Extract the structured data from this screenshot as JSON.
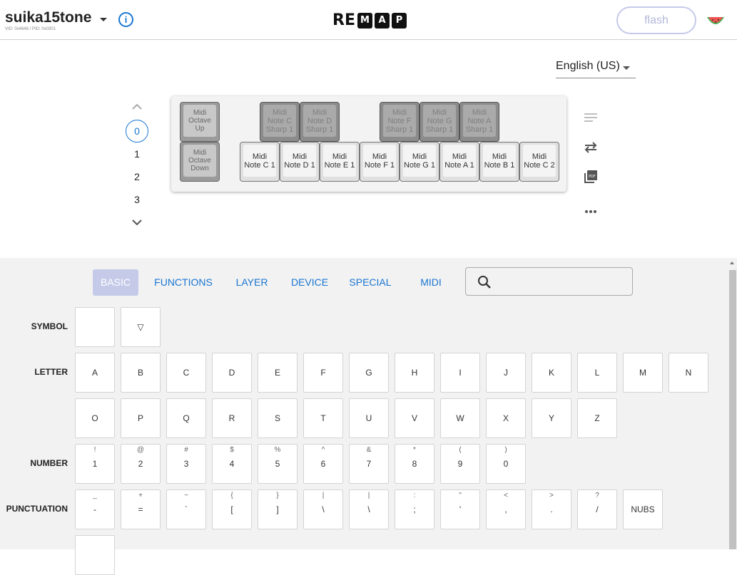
{
  "header": {
    "keyboard_name": "suika15tone",
    "vid_pid": "VID: 0x4648 / PID: 0x0301",
    "info_icon": "info-icon",
    "logo": [
      "R",
      "E",
      "M",
      "A",
      "P"
    ],
    "flash_label": "flash",
    "avatar_icon": "watermelon-icon"
  },
  "layout_select": {
    "value": "English (US)"
  },
  "layers": [
    "0",
    "1",
    "2",
    "3"
  ],
  "keyboard": {
    "top_row": [
      {
        "label": "Midi Octave Up"
      },
      {
        "label": "Midi Note C Sharp 1"
      },
      {
        "label": "Midi Note D Sharp 1"
      },
      {
        "label": "Midi Note F Sharp 1"
      },
      {
        "label": "Midi Note G Sharp 1"
      },
      {
        "label": "Midi Note A Sharp 1"
      }
    ],
    "bottom_row": [
      {
        "label": "Midi Octave Down"
      },
      {
        "label": "Midi Note C 1"
      },
      {
        "label": "Midi Note D 1"
      },
      {
        "label": "Midi Note E 1"
      },
      {
        "label": "Midi Note F 1"
      },
      {
        "label": "Midi Note G 1"
      },
      {
        "label": "Midi Note A 1"
      },
      {
        "label": "Midi Note B 1"
      },
      {
        "label": "Midi Note C 2"
      }
    ]
  },
  "side_icons": [
    "notes-icon",
    "swap-icon",
    "pdf-icon",
    "more-icon"
  ],
  "tabs": [
    "BASIC",
    "FUNCTIONS",
    "LAYER",
    "DEVICE",
    "SPECIAL",
    "MIDI"
  ],
  "search": {
    "placeholder": ""
  },
  "categories": {
    "symbol": "SYMBOL",
    "letter": "LETTER",
    "number": "NUMBER",
    "punctuation": "PUNCTUATION"
  },
  "symbol_keys": [
    "",
    "▽"
  ],
  "letter_keys_row1": [
    "A",
    "B",
    "C",
    "D",
    "E",
    "F",
    "G",
    "H",
    "I",
    "J",
    "K",
    "L",
    "M",
    "N"
  ],
  "letter_keys_row2": [
    "O",
    "P",
    "Q",
    "R",
    "S",
    "T",
    "U",
    "V",
    "W",
    "X",
    "Y",
    "Z"
  ],
  "number_keys": [
    {
      "shift": "!",
      "key": "1"
    },
    {
      "shift": "@",
      "key": "2"
    },
    {
      "shift": "#",
      "key": "3"
    },
    {
      "shift": "$",
      "key": "4"
    },
    {
      "shift": "%",
      "key": "5"
    },
    {
      "shift": "^",
      "key": "6"
    },
    {
      "shift": "&",
      "key": "7"
    },
    {
      "shift": "*",
      "key": "8"
    },
    {
      "shift": "(",
      "key": "9"
    },
    {
      "shift": ")",
      "key": "0"
    }
  ],
  "punct_keys": [
    {
      "shift": "_",
      "key": "-"
    },
    {
      "shift": "+",
      "key": "="
    },
    {
      "shift": "~",
      "key": "`"
    },
    {
      "shift": "{",
      "key": "["
    },
    {
      "shift": "}",
      "key": "]"
    },
    {
      "shift": "|",
      "key": "\\"
    },
    {
      "shift": "|",
      "key": "\\"
    },
    {
      "shift": ":",
      "key": ";"
    },
    {
      "shift": "\"",
      "key": "'"
    },
    {
      "shift": "<",
      "key": ","
    },
    {
      "shift": ">",
      "key": "."
    },
    {
      "shift": "?",
      "key": "/"
    },
    {
      "shift": "",
      "key": "NUBS"
    }
  ]
}
